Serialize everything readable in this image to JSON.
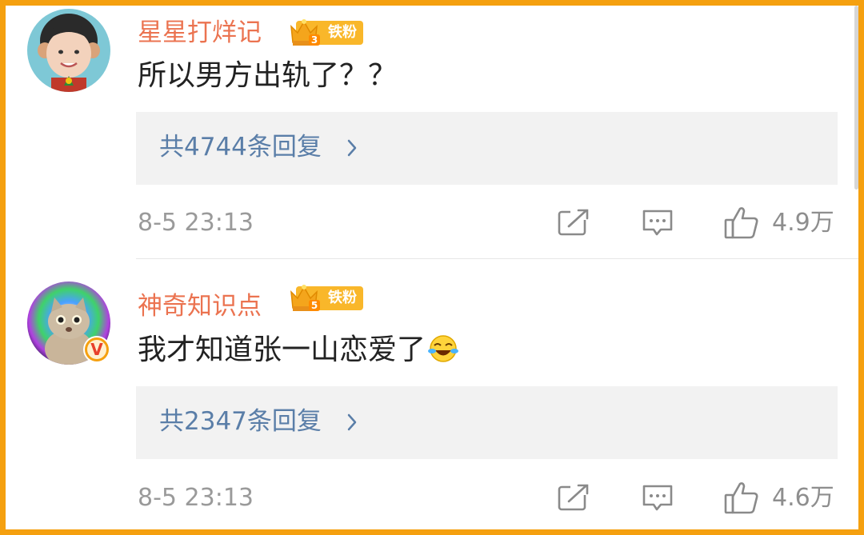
{
  "comments": [
    {
      "username": "星星打烊记",
      "fan_level": "3",
      "fan_badge": "铁粉",
      "text": "所以男方出轨了？？",
      "replies_label": "共4744条回复",
      "timestamp": "8-5 23:13",
      "likes": "4.9万",
      "avatar_icon": "avatar-boy-face",
      "verified": false
    },
    {
      "username": "神奇知识点",
      "fan_level": "5",
      "fan_badge": "铁粉",
      "text": "我才知道张一山恋爱了",
      "emoji": "laugh-cry-emoji",
      "replies_label": "共2347条回复",
      "timestamp": "8-5 23:13",
      "likes": "4.6万",
      "avatar_icon": "avatar-cat",
      "verified": true,
      "verified_mark": "V"
    }
  ],
  "icons": {
    "repost": "repost-icon",
    "comment": "comment-icon",
    "like": "like-icon",
    "chevron": "chevron-right-icon"
  },
  "colors": {
    "frame": "#f5a00f",
    "username": "#eb7350",
    "reply_link": "#5a7ea8",
    "badge": "#f9b72a"
  }
}
